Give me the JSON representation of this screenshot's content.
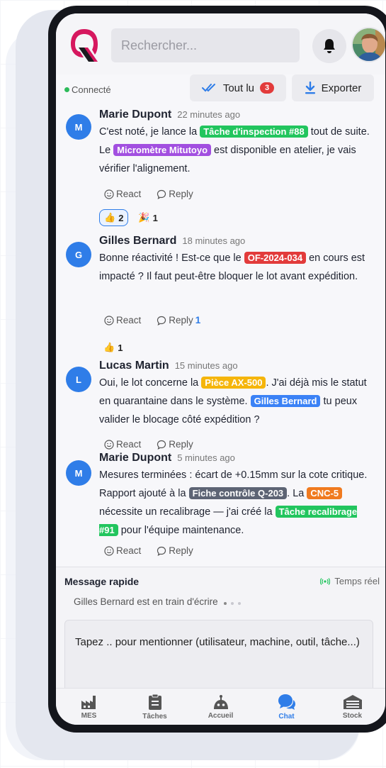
{
  "header": {
    "search_placeholder": "Rechercher...",
    "logo_letter": "Q"
  },
  "toolbar": {
    "status": "Connecté",
    "mark_read_label": "Tout lu",
    "unread_count": "3",
    "export_label": "Exporter"
  },
  "messages": [
    {
      "initial": "M",
      "author": "Marie Dupont",
      "time": "22 minutes ago",
      "segments": [
        {
          "text": "C'est noté, je lance la "
        },
        {
          "tag": "green",
          "text": "Tâche d'inspection #88"
        },
        {
          "text": " tout de suite. Le "
        },
        {
          "tag": "purple",
          "text": "Micromètre Mitutoyo"
        },
        {
          "text": " est disponible en atelier, je vais vérifier l'alignement."
        }
      ],
      "react_label": "React",
      "reply_label": "Reply",
      "reply_count": "",
      "reactions": [
        {
          "emoji": "👍",
          "count": "2",
          "active": true
        },
        {
          "emoji": "🎉",
          "count": "1",
          "active": false
        }
      ]
    },
    {
      "initial": "G",
      "author": "Gilles Bernard",
      "time": "18 minutes ago",
      "segments": [
        {
          "text": "Bonne réactivité ! Est-ce que le "
        },
        {
          "tag": "red",
          "text": "OF-2024-034"
        },
        {
          "text": " en cours est impacté ? Il faut peut-être bloquer le lot avant expédition."
        }
      ],
      "react_label": "React",
      "reply_label": "Reply",
      "reply_count": "1",
      "reactions": [
        {
          "emoji": "👍",
          "count": "1",
          "active": false
        }
      ]
    },
    {
      "initial": "L",
      "author": "Lucas Martin",
      "time": "15 minutes ago",
      "segments": [
        {
          "text": "Oui, le lot concerne la "
        },
        {
          "tag": "yellow",
          "text": "Pièce AX-500"
        },
        {
          "text": ". J'ai déjà mis le statut en quarantaine dans le système. "
        },
        {
          "tag": "blue",
          "text": "Gilles Bernard"
        },
        {
          "text": " tu peux valider le blocage côté expédition ?"
        }
      ],
      "react_label": "React",
      "reply_label": "Reply",
      "reply_count": "",
      "reactions": []
    },
    {
      "initial": "M",
      "author": "Marie Dupont",
      "time": "5 minutes ago",
      "segments": [
        {
          "text": "Mesures terminées : écart de +0.15mm sur la cote critique. Rapport ajouté à la "
        },
        {
          "tag": "gray",
          "text": "Fiche contrôle Q-203"
        },
        {
          "text": ". La "
        },
        {
          "tag": "orange",
          "text": "CNC-5"
        },
        {
          "text": " nécessite un recalibrage — j'ai créé la "
        },
        {
          "tag": "green",
          "text": "Tâche recalibrage #91"
        },
        {
          "text": " pour l'équipe maintenance."
        }
      ],
      "react_label": "React",
      "reply_label": "Reply",
      "reply_count": "",
      "reactions": []
    }
  ],
  "composer": {
    "title": "Message rapide",
    "realtime_label": "Temps réel",
    "typing_text": "Gilles Bernard est en train d'écrire",
    "placeholder": "Tapez .. pour mentionner (utilisateur, machine, outil, tâche...)"
  },
  "nav": {
    "items": [
      {
        "label": "MES",
        "icon": "factory-icon",
        "active": false
      },
      {
        "label": "Tâches",
        "icon": "clipboard-icon",
        "active": false
      },
      {
        "label": "Accueil",
        "icon": "robot-icon",
        "active": false
      },
      {
        "label": "Chat",
        "icon": "chat-bubbles-icon",
        "active": true
      },
      {
        "label": "Stock",
        "icon": "warehouse-icon",
        "active": false
      }
    ]
  },
  "colors": {
    "accent": "#2f7de8",
    "danger": "#e23b3b",
    "success": "#22c55e",
    "purple": "#a24fe0",
    "yellow": "#f5b50b",
    "gray": "#5d6474",
    "orange": "#f07a1f"
  }
}
